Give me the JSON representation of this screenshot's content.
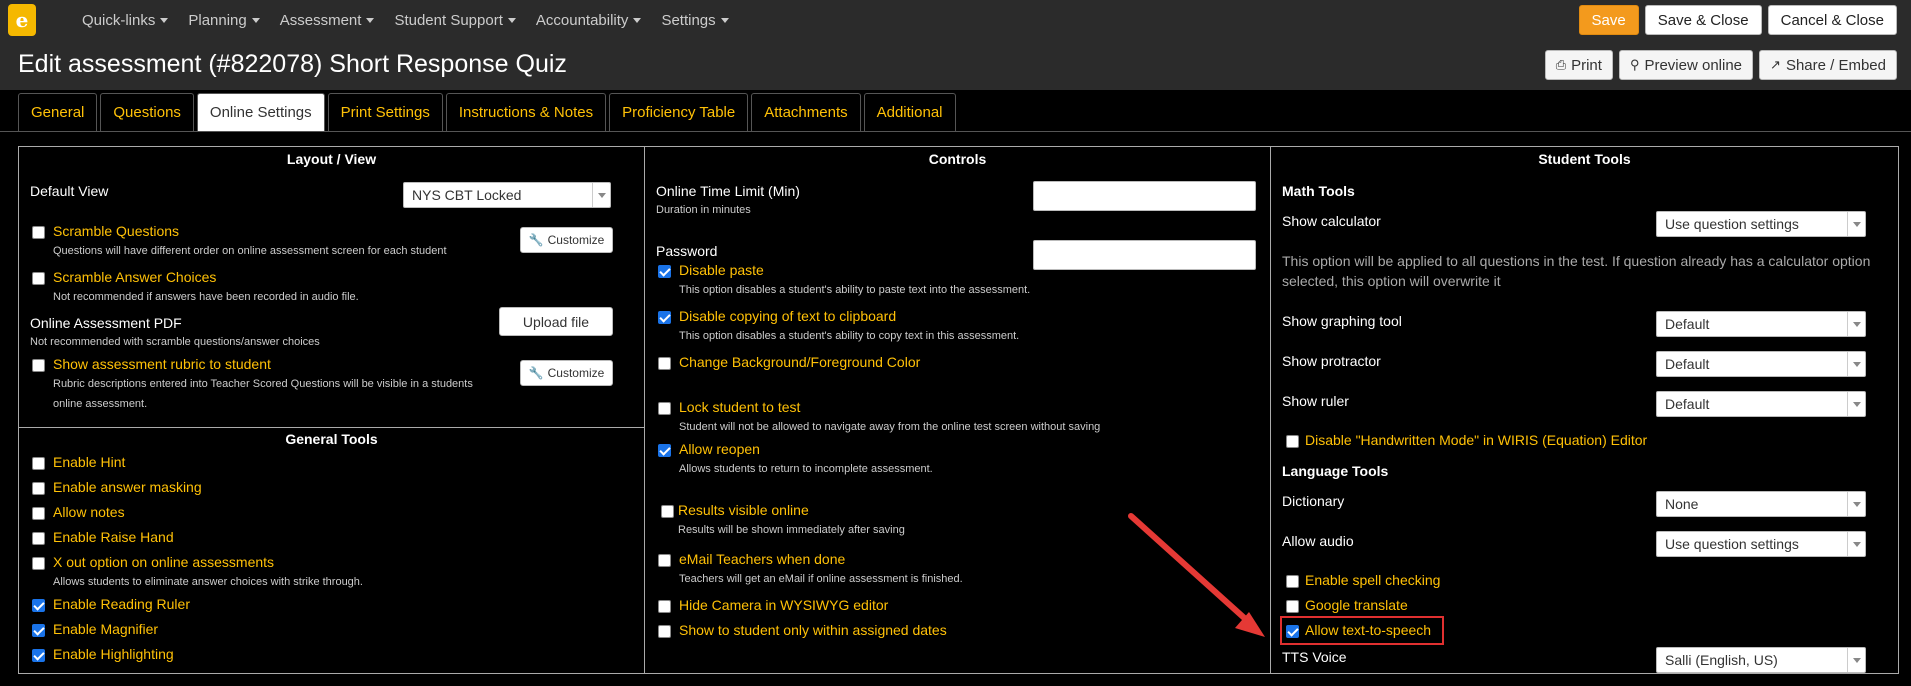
{
  "logo": {
    "glyph": "e"
  },
  "nav": {
    "items": [
      "Quick-links",
      "Planning",
      "Assessment",
      "Student Support",
      "Accountability",
      "Settings"
    ]
  },
  "top_buttons": {
    "save": "Save",
    "save_close": "Save & Close",
    "cancel_close": "Cancel & Close"
  },
  "title": "Edit assessment (#822078) Short Response Quiz",
  "title_buttons": {
    "print": "Print",
    "preview": "Preview online",
    "share": "Share / Embed"
  },
  "tabs": [
    "General",
    "Questions",
    "Online Settings",
    "Print Settings",
    "Instructions & Notes",
    "Proficiency Table",
    "Attachments",
    "Additional"
  ],
  "layout": {
    "heading": "Layout / View",
    "default_view_label": "Default View",
    "default_view_value": "NYS CBT Locked",
    "scramble_questions": "Scramble Questions",
    "scramble_questions_desc": "Questions will have different order on online assessment screen for each student",
    "customize": "Customize",
    "scramble_answers": "Scramble Answer Choices",
    "scramble_answers_desc": "Not recommended if answers have been recorded in audio file.",
    "pdf_label": "Online Assessment PDF",
    "pdf_desc": "Not recommended with scramble questions/answer choices",
    "upload": "Upload file",
    "rubric": "Show assessment rubric to student",
    "rubric_desc1": "Rubric descriptions entered into Teacher Scored Questions will be visible in a students",
    "rubric_desc2": "online assessment."
  },
  "general_tools": {
    "heading": "General Tools",
    "hint": "Enable Hint",
    "masking": "Enable answer masking",
    "notes": "Allow notes",
    "raise_hand": "Enable Raise Hand",
    "xout": "X out option on online assessments",
    "xout_desc": "Allows students to eliminate answer choices with strike through.",
    "ruler": "Enable Reading Ruler",
    "magnifier": "Enable Magnifier",
    "highlighting": "Enable Highlighting"
  },
  "controls": {
    "heading": "Controls",
    "time_limit": "Online Time Limit (Min)",
    "time_desc": "Duration in minutes",
    "password": "Password",
    "disable_paste": "Disable paste",
    "disable_paste_desc": "This option disables a student's ability to paste text into the assessment.",
    "disable_copy": "Disable copying of text to clipboard",
    "disable_copy_desc": "This option disables a student's ability to copy text in this assessment.",
    "bg_color": "Change Background/Foreground Color",
    "lock": "Lock student to test",
    "lock_desc": "Student will not be allowed to navigate away from the online test screen without saving",
    "reopen": "Allow reopen",
    "reopen_desc": "Allows students to return to incomplete assessment.",
    "results": "Results visible online",
    "results_desc": "Results will be shown immediately after saving",
    "email": "eMail Teachers when done",
    "email_desc": "Teachers will get an eMail if online assessment is finished.",
    "camera": "Hide Camera in WYSIWYG editor",
    "dates": "Show to student only within assigned dates"
  },
  "student_tools": {
    "heading": "Student Tools",
    "math_heading": "Math Tools",
    "calculator": "Show calculator",
    "calculator_value": "Use question settings",
    "calc_note1": "This option will be applied to all questions in the test. If question already has a calculator option",
    "calc_note2": "selected, this option will overwrite it",
    "graphing": "Show graphing tool",
    "graphing_value": "Default",
    "protractor": "Show protractor",
    "protractor_value": "Default",
    "ruler": "Show ruler",
    "ruler_value": "Default",
    "wiris": "Disable \"Handwritten Mode\" in WIRIS (Equation) Editor",
    "language_heading": "Language Tools",
    "dictionary": "Dictionary",
    "dictionary_value": "None",
    "audio": "Allow audio",
    "audio_value": "Use question settings",
    "spell": "Enable spell checking",
    "translate": "Google translate",
    "tts": "Allow text-to-speech",
    "tts_voice": "TTS Voice",
    "tts_voice_value": "Salli (English, US)"
  }
}
